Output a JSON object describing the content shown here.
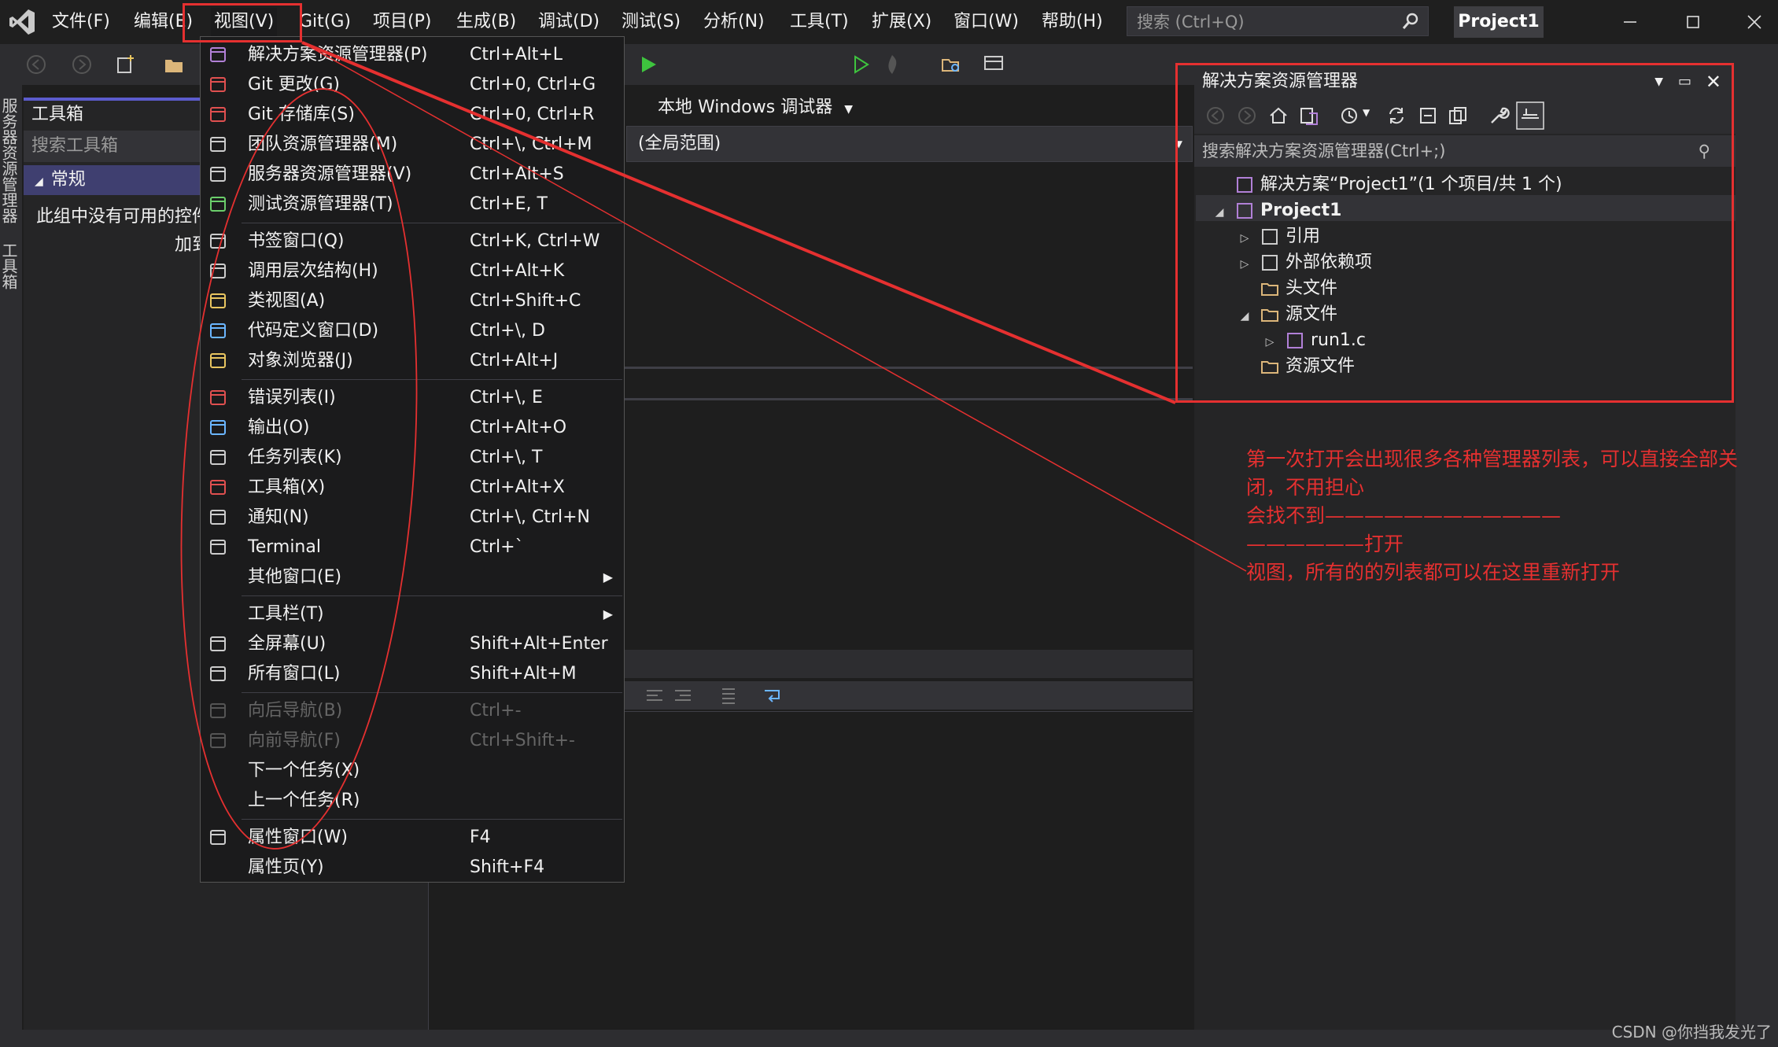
{
  "menubar": {
    "items": [
      "文件(F)",
      "编辑(E)",
      "视图(V)",
      "Git(G)",
      "项目(P)",
      "生成(B)",
      "调试(D)",
      "测试(S)",
      "分析(N)",
      "工具(T)",
      "扩展(X)",
      "窗口(W)",
      "帮助(H)"
    ],
    "search_placeholder": "搜索 (Ctrl+Q)",
    "project_name": "Project1"
  },
  "toolbar": {
    "debug_label": "本地 Windows 调试器"
  },
  "left_tabs": [
    "服务器资源管理器",
    "工具箱"
  ],
  "toolbox": {
    "title": "工具箱",
    "search_placeholder": "搜索工具箱",
    "group": "常规",
    "empty_line1": "此组中没有可用的控件",
    "empty_line2": "加到"
  },
  "editor": {
    "scope": "(全局范围)"
  },
  "view_menu": {
    "groups": [
      [
        {
          "label": "解决方案资源管理器(P)",
          "shortcut": "Ctrl+Alt+L",
          "icon": "solution-explorer-icon"
        },
        {
          "label": "Git 更改(G)",
          "shortcut": "Ctrl+0, Ctrl+G",
          "icon": "git-changes-icon"
        },
        {
          "label": "Git 存储库(S)",
          "shortcut": "Ctrl+0, Ctrl+R",
          "icon": "git-repo-icon"
        },
        {
          "label": "团队资源管理器(M)",
          "shortcut": "Ctrl+\\, Ctrl+M",
          "icon": "team-explorer-icon"
        },
        {
          "label": "服务器资源管理器(V)",
          "shortcut": "Ctrl+Alt+S",
          "icon": "server-explorer-icon"
        },
        {
          "label": "测试资源管理器(T)",
          "shortcut": "Ctrl+E, T",
          "icon": "test-explorer-icon"
        }
      ],
      [
        {
          "label": "书签窗口(Q)",
          "shortcut": "Ctrl+K, Ctrl+W",
          "icon": "bookmark-icon"
        },
        {
          "label": "调用层次结构(H)",
          "shortcut": "Ctrl+Alt+K",
          "icon": "call-hierarchy-icon"
        },
        {
          "label": "类视图(A)",
          "shortcut": "Ctrl+Shift+C",
          "icon": "class-view-icon"
        },
        {
          "label": "代码定义窗口(D)",
          "shortcut": "Ctrl+\\, D",
          "icon": "code-definition-icon"
        },
        {
          "label": "对象浏览器(J)",
          "shortcut": "Ctrl+Alt+J",
          "icon": "object-browser-icon"
        }
      ],
      [
        {
          "label": "错误列表(I)",
          "shortcut": "Ctrl+\\, E",
          "icon": "error-list-icon"
        },
        {
          "label": "输出(O)",
          "shortcut": "Ctrl+Alt+O",
          "icon": "output-icon"
        },
        {
          "label": "任务列表(K)",
          "shortcut": "Ctrl+\\, T",
          "icon": "task-list-icon"
        },
        {
          "label": "工具箱(X)",
          "shortcut": "Ctrl+Alt+X",
          "icon": "toolbox-icon"
        },
        {
          "label": "通知(N)",
          "shortcut": "Ctrl+\\, Ctrl+N",
          "icon": "bell-icon"
        },
        {
          "label": "Terminal",
          "shortcut": "Ctrl+`",
          "icon": "terminal-icon"
        },
        {
          "label": "其他窗口(E)",
          "shortcut": "",
          "icon": "",
          "submenu": true
        }
      ],
      [
        {
          "label": "工具栏(T)",
          "shortcut": "",
          "icon": "",
          "submenu": true
        },
        {
          "label": "全屏幕(U)",
          "shortcut": "Shift+Alt+Enter",
          "icon": "fullscreen-icon"
        },
        {
          "label": "所有窗口(L)",
          "shortcut": "Shift+Alt+M",
          "icon": "all-windows-icon"
        }
      ],
      [
        {
          "label": "向后导航(B)",
          "shortcut": "Ctrl+-",
          "icon": "navigate-back-icon",
          "disabled": true
        },
        {
          "label": "向前导航(F)",
          "shortcut": "Ctrl+Shift+-",
          "icon": "navigate-forward-icon",
          "disabled": true
        },
        {
          "label": "下一个任务(X)",
          "shortcut": "",
          "icon": ""
        },
        {
          "label": "上一个任务(R)",
          "shortcut": "",
          "icon": ""
        }
      ],
      [
        {
          "label": "属性窗口(W)",
          "shortcut": "F4",
          "icon": "wrench-icon"
        },
        {
          "label": "属性页(Y)",
          "shortcut": "Shift+F4",
          "icon": ""
        }
      ]
    ]
  },
  "solution_explorer": {
    "title": "解决方案资源管理器",
    "search_placeholder": "搜索解决方案资源管理器(Ctrl+;)",
    "tree": [
      {
        "label": "解决方案“Project1”(1 个项目/共 1 个)",
        "level": 0,
        "toggle": "",
        "icon": "solution-icon"
      },
      {
        "label": "Project1",
        "level": 0,
        "toggle": "◢",
        "icon": "project-icon",
        "bold": true
      },
      {
        "label": "引用",
        "level": 1,
        "toggle": "▷",
        "icon": "references-icon"
      },
      {
        "label": "外部依赖项",
        "level": 1,
        "toggle": "▷",
        "icon": "external-deps-icon"
      },
      {
        "label": "头文件",
        "level": 1,
        "toggle": "",
        "icon": "folder-icon"
      },
      {
        "label": "源文件",
        "level": 1,
        "toggle": "◢",
        "icon": "folder-open-icon"
      },
      {
        "label": "run1.c",
        "level": 2,
        "toggle": "▷",
        "icon": "c-file-icon"
      },
      {
        "label": "资源文件",
        "level": 1,
        "toggle": "",
        "icon": "folder-icon"
      }
    ]
  },
  "annotation": {
    "lines": [
      "第一次打开会出现很多各种管理器列表，可以直接全部关",
      "闭，不用担心",
      "会找不到————————————",
      "——————打开",
      "视图，所有的的列表都可以在这里重新打开"
    ],
    "color": "#e53030"
  },
  "watermark": "CSDN @你挡我发光了"
}
